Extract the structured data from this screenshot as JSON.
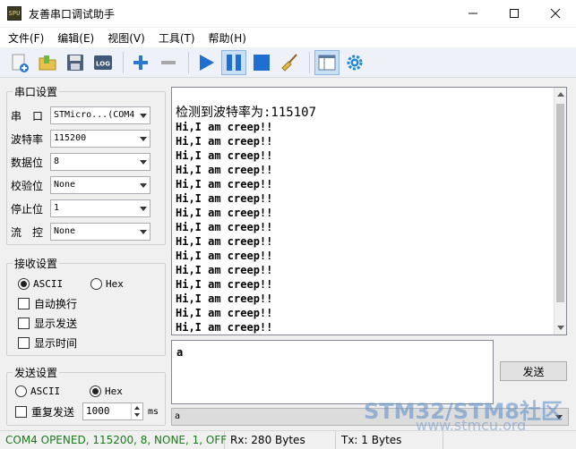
{
  "window": {
    "title": "友善串口调试助手",
    "icon_text": "SPU"
  },
  "menu": [
    "文件(F)",
    "编辑(E)",
    "视图(V)",
    "工具(T)",
    "帮助(H)"
  ],
  "toolbar": {
    "icons": [
      "new-plus-icon",
      "open-folder-icon",
      "save-disk-icon",
      "log-icon",
      "add-icon",
      "remove-icon",
      "play-icon",
      "pause-icon",
      "stop-icon",
      "broom-clear-icon",
      "layout-icon",
      "gear-icon"
    ],
    "log_label": "LOG"
  },
  "serial_settings": {
    "title": "串口设置",
    "fields": [
      {
        "label": "串　口",
        "value": "STMicro...(COM4"
      },
      {
        "label": "波特率",
        "value": "115200"
      },
      {
        "label": "数据位",
        "value": "8"
      },
      {
        "label": "校验位",
        "value": "None"
      },
      {
        "label": "停止位",
        "value": "1"
      },
      {
        "label": "流　控",
        "value": "None"
      }
    ]
  },
  "receive_settings": {
    "title": "接收设置",
    "ascii": "ASCII",
    "hex": "Hex",
    "auto_wrap": "自动换行",
    "show_sent": "显示发送",
    "show_time": "显示时间"
  },
  "send_settings": {
    "title": "发送设置",
    "ascii": "ASCII",
    "hex": "Hex",
    "repeat": "重复发送",
    "interval": "1000",
    "unit": "ms"
  },
  "receive": {
    "lines": [
      "检测到波特率为:115107",
      "Hi,I am creep!!",
      "Hi,I am creep!!",
      "Hi,I am creep!!",
      "Hi,I am creep!!",
      "Hi,I am creep!!",
      "Hi,I am creep!!",
      "Hi,I am creep!!",
      "Hi,I am creep!!",
      "Hi,I am creep!!",
      "Hi,I am creep!!",
      "Hi,I am creep!!",
      "Hi,I am creep!!",
      "Hi,I am creep!!",
      "Hi,I am creep!!",
      "Hi,I am creep!!"
    ]
  },
  "send": {
    "input": "a",
    "button": "发送",
    "history": "a"
  },
  "status": {
    "port": "COM4 OPENED, 115200, 8, NONE, 1, OFF",
    "rx": "Rx: 280 Bytes",
    "tx": "Tx: 1 Bytes"
  },
  "watermark": {
    "brand": "STM32/STM8社区",
    "url": "www.stmcu.org"
  },
  "colors": {
    "status_text": "#1a7a1a",
    "accent_blue": "#1e6fd0",
    "watermark": "#5a8cc8"
  }
}
